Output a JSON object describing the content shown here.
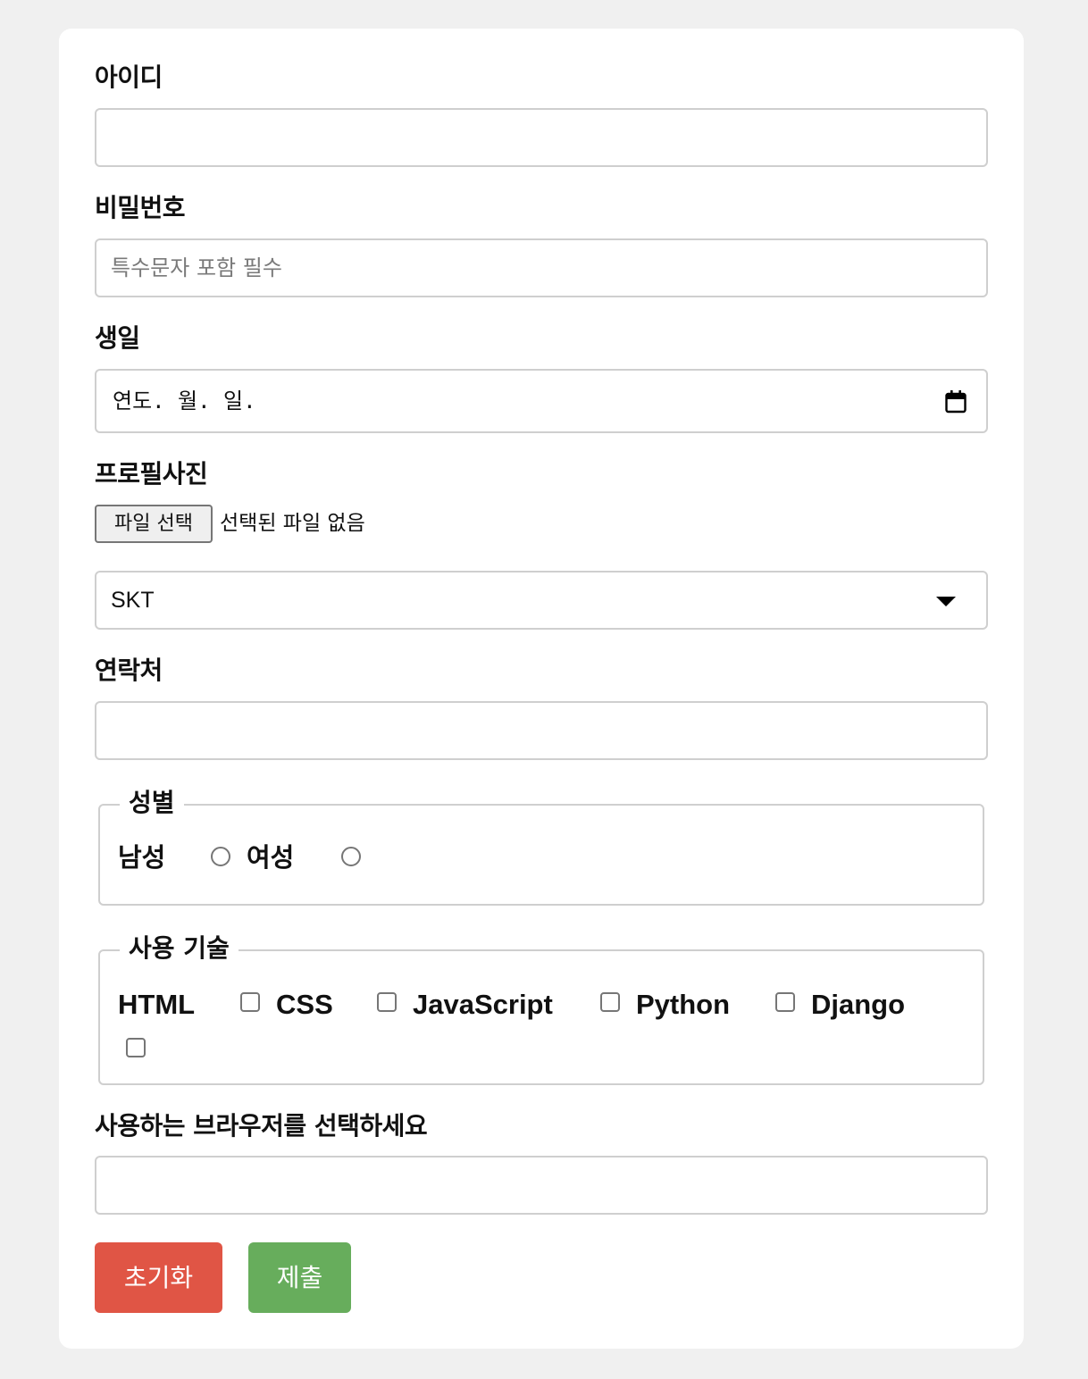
{
  "form": {
    "id": {
      "label": "아이디",
      "value": ""
    },
    "password": {
      "label": "비밀번호",
      "placeholder": "특수문자 포함 필수"
    },
    "birthday": {
      "label": "생일",
      "display": "연도. 월. 일."
    },
    "photo": {
      "label": "프로필사진",
      "button_label": "파일 선택",
      "status": "선택된 파일 없음"
    },
    "carrier": {
      "selected": "SKT"
    },
    "contact": {
      "label": "연락처",
      "value": ""
    },
    "gender": {
      "legend": "성별",
      "options": [
        "남성",
        "여성"
      ]
    },
    "skills": {
      "legend": "사용 기술",
      "options": [
        "HTML",
        "CSS",
        "JavaScript",
        "Python",
        "Django"
      ]
    },
    "browser": {
      "label": "사용하는 브라우저를 선택하세요",
      "value": ""
    },
    "buttons": {
      "reset_label": "초기화",
      "submit_label": "제출"
    }
  },
  "colors": {
    "reset": "#e05545",
    "submit": "#67ad5c",
    "background": "#f0f0f0",
    "card": "#ffffff"
  },
  "icons": {
    "date_picker": "calendar-icon",
    "select_arrow": "chevron-down-icon"
  }
}
